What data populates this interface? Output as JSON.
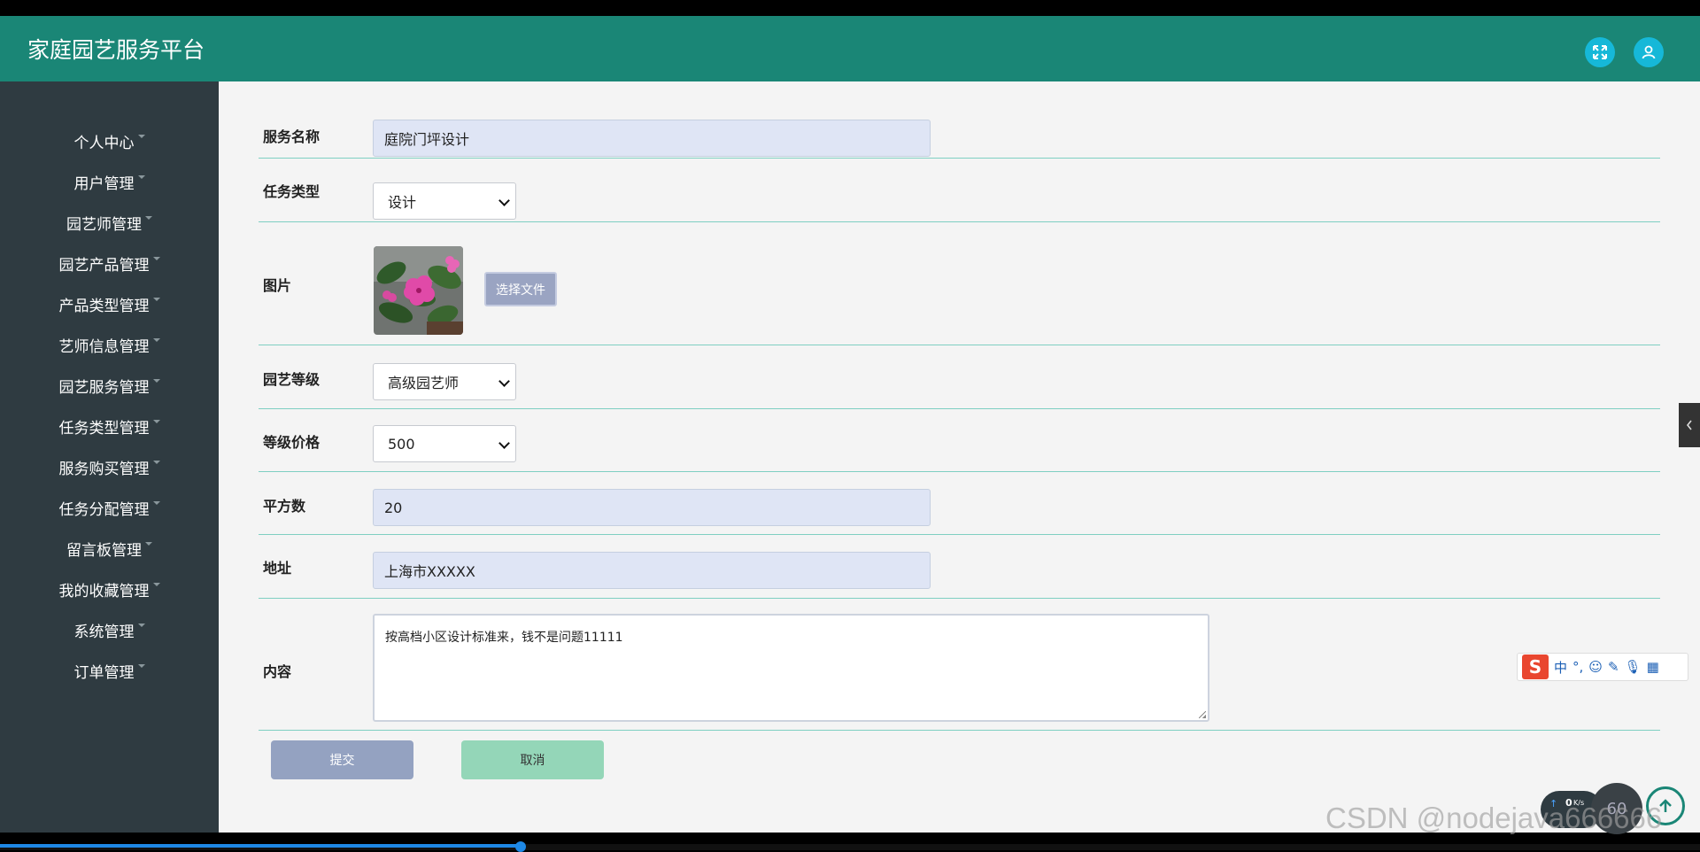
{
  "app": {
    "title": "家庭园艺服务平台"
  },
  "sidebar": {
    "items": [
      {
        "label": "个人中心"
      },
      {
        "label": "用户管理"
      },
      {
        "label": "园艺师管理"
      },
      {
        "label": "园艺产品管理"
      },
      {
        "label": "产品类型管理"
      },
      {
        "label": "艺师信息管理"
      },
      {
        "label": "园艺服务管理"
      },
      {
        "label": "任务类型管理"
      },
      {
        "label": "服务购买管理"
      },
      {
        "label": "任务分配管理"
      },
      {
        "label": "留言板管理"
      },
      {
        "label": "我的收藏管理"
      },
      {
        "label": "系统管理"
      },
      {
        "label": "订单管理"
      }
    ]
  },
  "form": {
    "service_name": {
      "label": "服务名称",
      "value": "庭院门坪设计"
    },
    "task_type": {
      "label": "任务类型",
      "value": "设计"
    },
    "image": {
      "label": "图片",
      "button": "选择文件"
    },
    "level": {
      "label": "园艺等级",
      "value": "高级园艺师"
    },
    "price": {
      "label": "等级价格",
      "value": "500"
    },
    "area": {
      "label": "平方数",
      "value": "20"
    },
    "address": {
      "label": "地址",
      "value": "上海市XXXXX"
    },
    "content": {
      "label": "内容",
      "value": "按高档小区设计标准来，钱不是问题11111"
    },
    "submit_label": "提交",
    "cancel_label": "取消"
  },
  "overlay": {
    "ime_s": "S",
    "ime_mode": "中",
    "speed_value": "0",
    "speed_unit": "K/s",
    "fps": "60",
    "watermark": "CSDN @nodejava666666"
  },
  "video": {
    "progress": 0.306
  },
  "colors": {
    "header": "#1a8676",
    "sidebar": "#2f3b41",
    "accent": "#16b8d8"
  }
}
